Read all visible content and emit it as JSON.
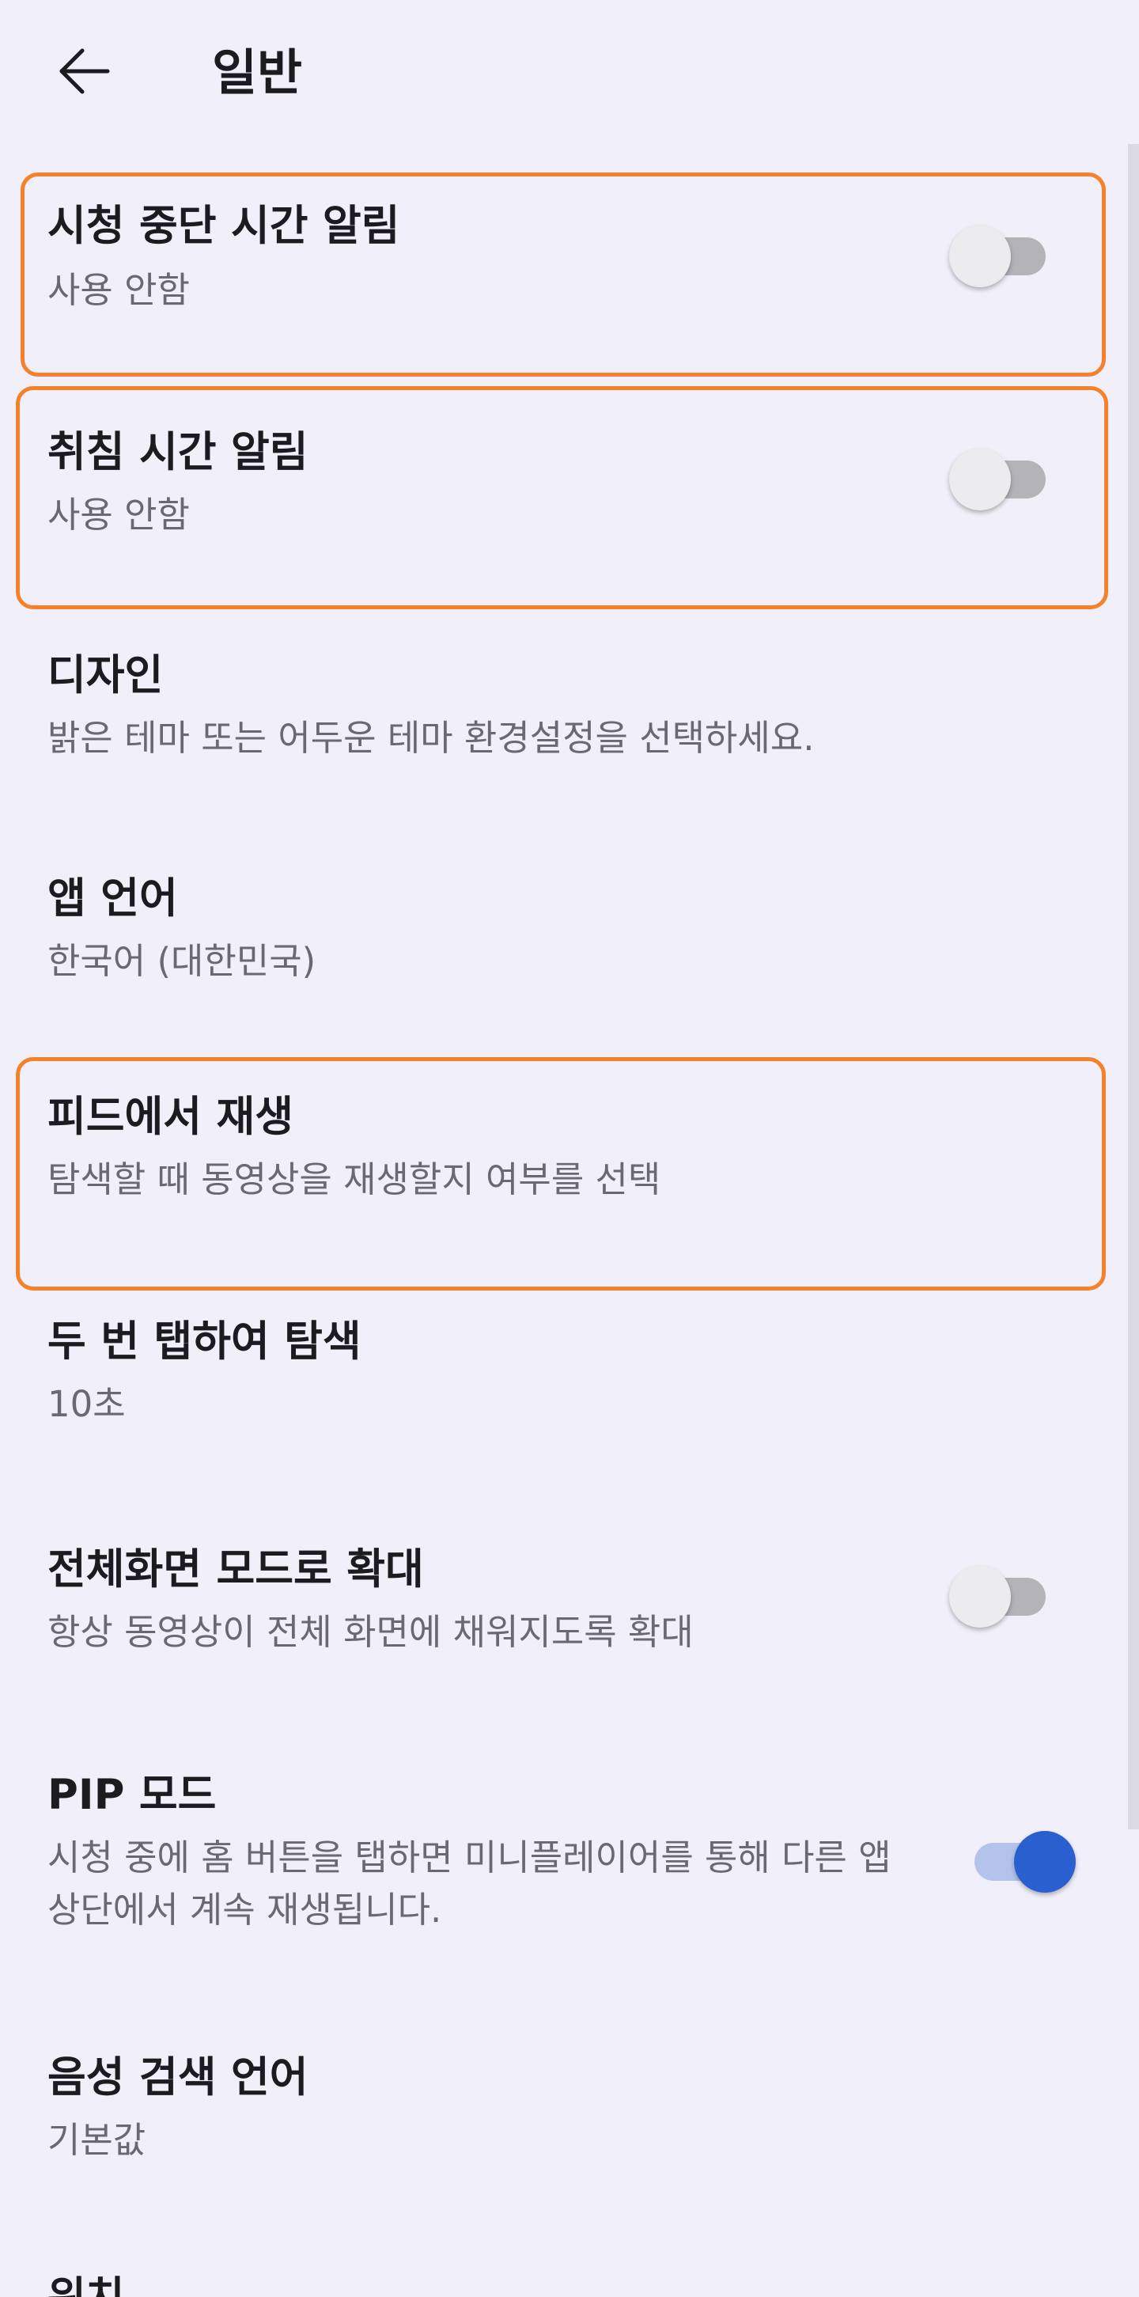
{
  "header": {
    "title": "일반",
    "back_icon": "arrow-left-icon"
  },
  "settings": [
    {
      "title": "시청 중단 시간 알림",
      "subtitle": "사용 안함",
      "toggle": false
    },
    {
      "title": "취침 시간 알림",
      "subtitle": "사용 안함",
      "toggle": false
    },
    {
      "title": "디자인",
      "subtitle": "밝은 테마 또는 어두운 테마 환경설정을 선택하세요."
    },
    {
      "title": "앱 언어",
      "subtitle": "한국어 (대한민국)"
    },
    {
      "title": "피드에서 재생",
      "subtitle": "탐색할 때 동영상을 재생할지 여부를 선택"
    },
    {
      "title": "두 번 탭하여 탐색",
      "subtitle": "10초"
    },
    {
      "title": "전체화면 모드로 확대",
      "subtitle": "항상 동영상이 전체 화면에 채워지도록 확대",
      "toggle": false
    },
    {
      "title": "PIP 모드",
      "subtitle": "시청 중에 홈 버튼을 탭하면 미니플레이어를 통해 다른 앱 상단에서 계속 재생됩니다.",
      "toggle": true
    },
    {
      "title": "음성 검색 언어",
      "subtitle": "기본값"
    },
    {
      "title": "위치"
    }
  ],
  "colors": {
    "background": "#f1eff9",
    "highlight": "#f5822b",
    "toggle_on": "#2a5fcf",
    "toggle_off": "#b4b3b8"
  }
}
